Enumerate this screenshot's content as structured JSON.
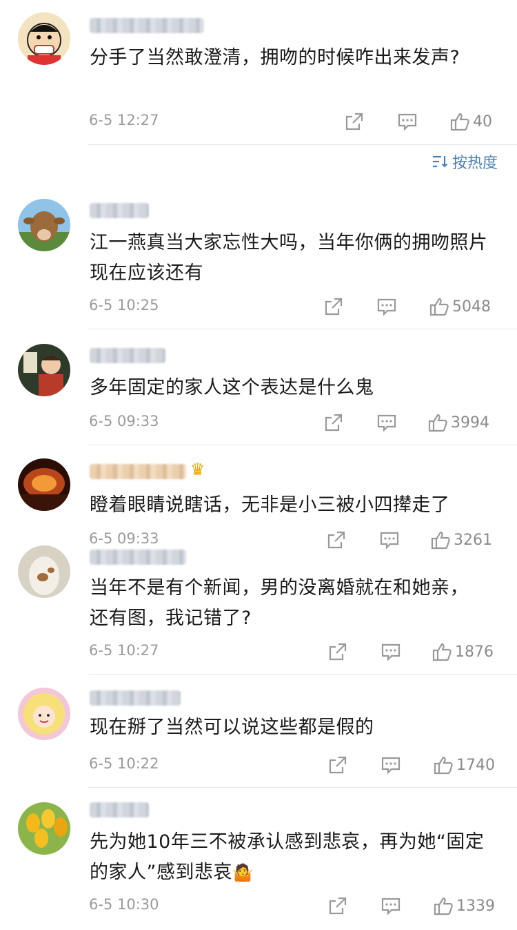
{
  "sort": {
    "label": "按热度"
  },
  "comments": [
    {
      "text": "分手了当然敢澄清，拥吻的时候咋出来发声?",
      "time": "6-5 12:27",
      "likes": "40"
    },
    {
      "text": "江一燕真当大家忘性大吗，当年你俩的拥吻照片现在应该还有",
      "time": "6-5 10:25",
      "likes": "5048"
    },
    {
      "text": "多年固定的家人这个表达是什么鬼",
      "time": "6-5 09:33",
      "likes": "3994"
    },
    {
      "text": "瞪着眼睛说瞎话，无非是小三被小四撵走了",
      "time": "6-5 09:33",
      "likes": "3261"
    },
    {
      "text": "当年不是有个新闻，男的没离婚就在和她亲，还有图，我记错了?",
      "time": "6-5 10:27",
      "likes": "1876"
    },
    {
      "text": "现在掰了当然可以说这些都是假的",
      "time": "6-5 10:22",
      "likes": "1740"
    },
    {
      "text": "先为她10年三不被承认感到悲哀，再为她“固定的家人”感到悲哀",
      "time": "6-5 10:30",
      "likes": "1339",
      "emoji": "🤷"
    }
  ]
}
